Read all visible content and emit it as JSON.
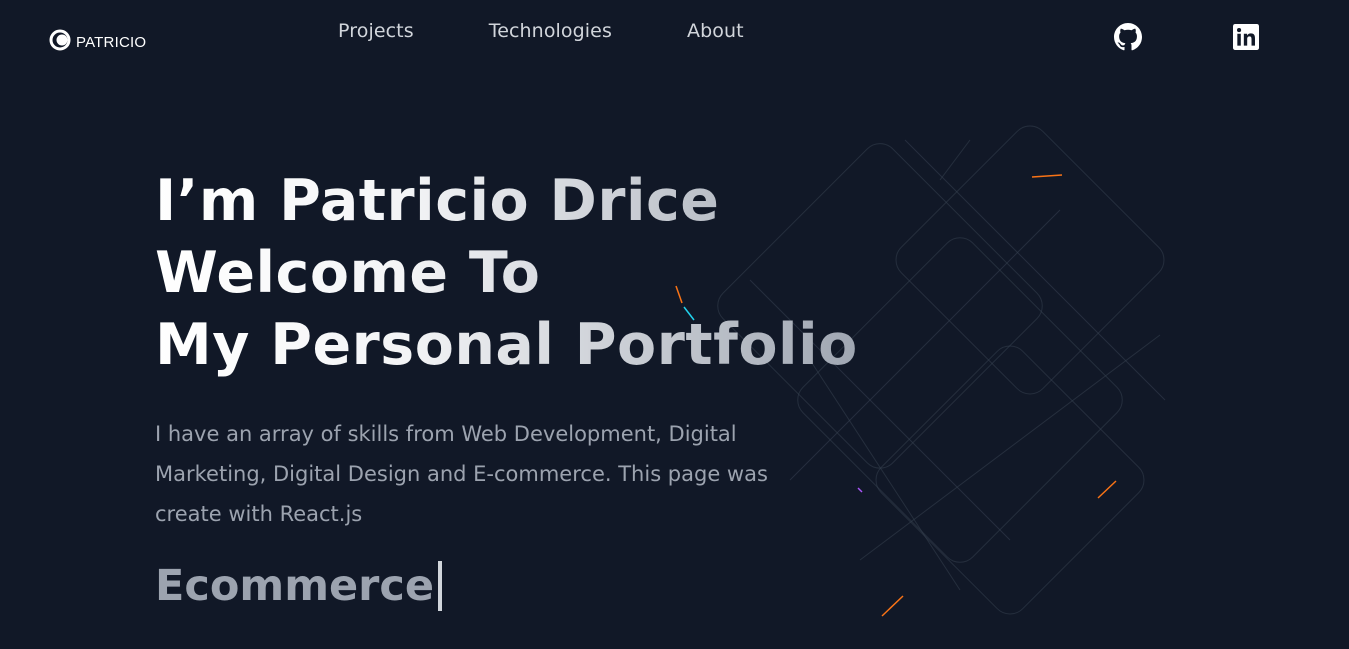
{
  "header": {
    "logo_text": "PATRICIO",
    "nav": [
      {
        "label": "Projects"
      },
      {
        "label": "Technologies"
      },
      {
        "label": "About"
      }
    ],
    "social": [
      {
        "icon": "github-icon"
      },
      {
        "icon": "linkedin-icon"
      }
    ]
  },
  "hero": {
    "title_lines": [
      "I’m Patricio Drice",
      "Welcome To",
      "My Personal Portfolio"
    ],
    "description": "I have an array of skills from Web Development, Digital Marketing, Digital Design and E-commerce. This page was create with React.js",
    "typed_word": "Ecommerce"
  },
  "colors": {
    "background": "#111827",
    "nav_text": "#d1d5db",
    "body_text": "#9ca3af",
    "accent_orange": "#f97316",
    "accent_cyan": "#22d3ee",
    "accent_purple": "#a855f7"
  }
}
